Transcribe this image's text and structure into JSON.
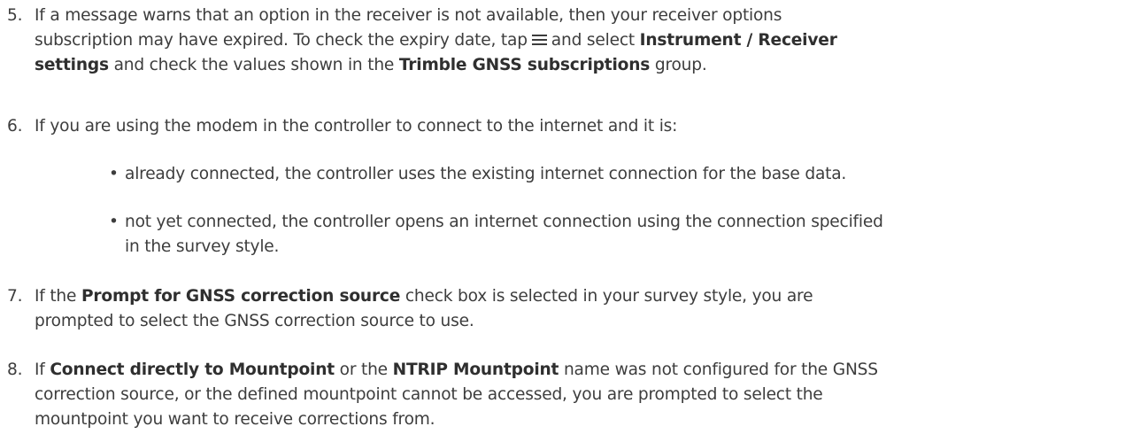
{
  "steps": [
    {
      "number": "5.",
      "line1": "If a message warns that an option in the receiver is not available, then your receiver options",
      "line2_a": "subscription may have expired. To check the expiry date, tap",
      "line2_b": "and select",
      "line2_bold": "Instrument / Receiver",
      "line3_bold": "settings",
      "line3_a": "and check the values shown in the",
      "line3_bold2": "Trimble GNSS subscriptions",
      "line3_b": "group.",
      "icon": "menu-icon"
    },
    {
      "number": "6.",
      "line1": "If you are using the modem in the controller to connect to the internet and it is:",
      "bullets": [
        {
          "marker": "•",
          "line1": "already connected, the controller uses the existing internet connection for the base data."
        },
        {
          "marker": "•",
          "line1": "not yet connected, the controller opens an internet connection using the connection specified",
          "line2": "in the survey style."
        }
      ]
    },
    {
      "number": "7.",
      "line1_a": "If the",
      "line1_bold": "Prompt for GNSS correction source",
      "line1_b": "check box is selected in your survey style, you are",
      "line2": "prompted to select the GNSS correction source to use."
    },
    {
      "number": "8.",
      "line1_a": "If",
      "line1_bold": "Connect directly to Mountpoint",
      "line1_b": "or the",
      "line1_bold2": "NTRIP Mountpoint",
      "line1_c": "name was not configured for the GNSS",
      "line2": "correction source, or the defined mountpoint cannot be accessed, you are prompted to select the",
      "line3": "mountpoint you want to receive corrections from."
    }
  ]
}
